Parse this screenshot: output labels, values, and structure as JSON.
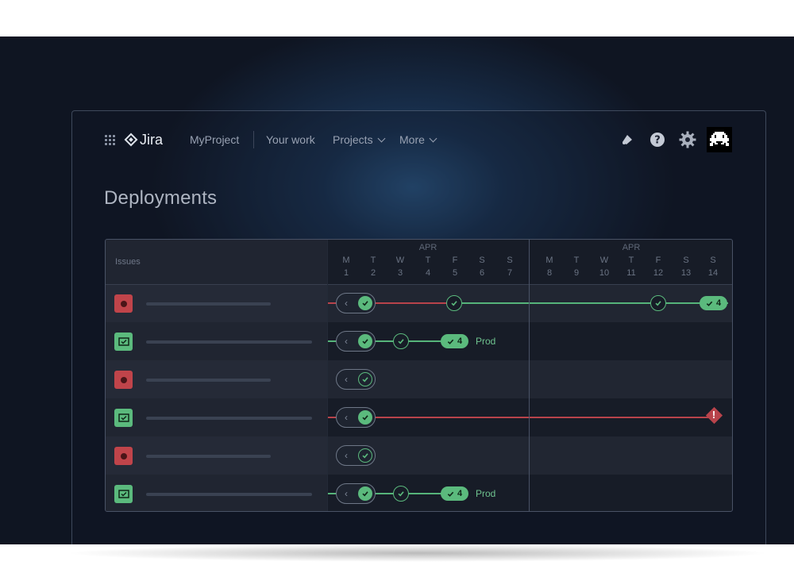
{
  "header": {
    "logo_text": "Jira",
    "project": "MyProject",
    "nav": {
      "your_work": "Your work",
      "projects": "Projects",
      "more": "More"
    }
  },
  "page": {
    "title": "Deployments"
  },
  "board": {
    "issues_header": "Issues",
    "weeks": [
      {
        "month": "APR",
        "days": [
          {
            "letter": "M",
            "num": "1"
          },
          {
            "letter": "T",
            "num": "2"
          },
          {
            "letter": "W",
            "num": "3"
          },
          {
            "letter": "T",
            "num": "4"
          },
          {
            "letter": "F",
            "num": "5"
          },
          {
            "letter": "S",
            "num": "6"
          },
          {
            "letter": "S",
            "num": "7"
          }
        ]
      },
      {
        "month": "APR",
        "days": [
          {
            "letter": "M",
            "num": "8"
          },
          {
            "letter": "T",
            "num": "9"
          },
          {
            "letter": "W",
            "num": "10"
          },
          {
            "letter": "T",
            "num": "11"
          },
          {
            "letter": "F",
            "num": "12"
          },
          {
            "letter": "S",
            "num": "13"
          },
          {
            "letter": "S",
            "num": "14"
          }
        ]
      }
    ],
    "rows": [
      {
        "type": "bug",
        "pill_count": "4",
        "env": ""
      },
      {
        "type": "story",
        "pill_count": "4",
        "env": "Prod"
      },
      {
        "type": "bug",
        "pill_count": "",
        "env": ""
      },
      {
        "type": "story",
        "pill_count": "",
        "env": "",
        "warning": "!"
      },
      {
        "type": "bug",
        "pill_count": "",
        "env": ""
      },
      {
        "type": "story",
        "pill_count": "4",
        "env": "Prod"
      }
    ]
  },
  "colors": {
    "success": "#5bba7d",
    "failure": "#b8434b",
    "bug": "#c0444a",
    "story": "#5bba7d"
  },
  "icons": [
    "app-switcher-icon",
    "jira-logo-icon",
    "notifications-icon",
    "help-icon",
    "settings-icon",
    "avatar"
  ]
}
